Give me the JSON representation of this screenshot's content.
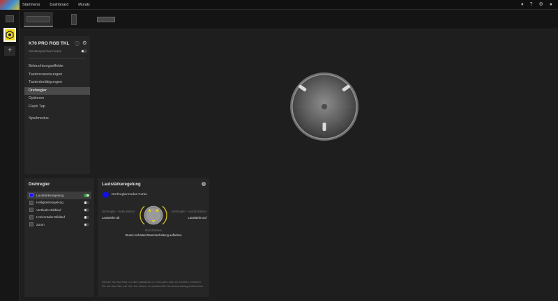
{
  "topbar": {
    "nav": [
      "Startmenü",
      "Dashboard",
      "Murals"
    ],
    "icons": [
      "bell-icon",
      "help-icon",
      "gear-icon",
      "user-icon"
    ]
  },
  "devices": [
    "keyboard",
    "pc-case",
    "hub"
  ],
  "left_panel": {
    "device_name": "K70 PRO RGB TKL",
    "storage_mode_label": "Gerätespeichermodus",
    "nav_items": [
      "Beleuchtungseffekte",
      "Tastenzuweisungen",
      "Tastenbetätigungen",
      "Drehregler",
      "Optionen",
      "Flash Tap",
      "Spielmodus"
    ],
    "active_item": "Drehregler"
  },
  "dial_panel": {
    "title": "Drehregler",
    "items": [
      {
        "label": "Lautstärkeregelung",
        "color": "#1515e0",
        "on": true
      },
      {
        "label": "Helligkeitsregelung",
        "color": "#4a4a4a",
        "on": false
      },
      {
        "label": "Vertikaler Bildlauf",
        "color": "#4a4a4a",
        "on": false
      },
      {
        "label": "Horizontaler Bildlauf",
        "color": "#4a4a4a",
        "on": false
      },
      {
        "label": "Zoom",
        "color": "#4a4a4a",
        "on": false
      }
    ]
  },
  "volume_panel": {
    "title": "Lautstärkeregelung",
    "color_label": "Drehreglermodus Farbe",
    "color": "#1010e6",
    "left_small": "Drehregler – links drehen",
    "left_big": "Lautstärke ab",
    "right_small": "Drehregler – rechts drehen",
    "right_big": "Lautstärke auf",
    "press_small": "Rad drücken",
    "press_big": "Stumm schalten/Stummschaltung aufheben",
    "help": "Drehen Sie das Rad, um die Lautstärke zu verringern oder zu erhöhen. Drücken Sie auf das Rad, um den Ton stumm zu schalten/die Stummschaltung aufzuheben."
  }
}
